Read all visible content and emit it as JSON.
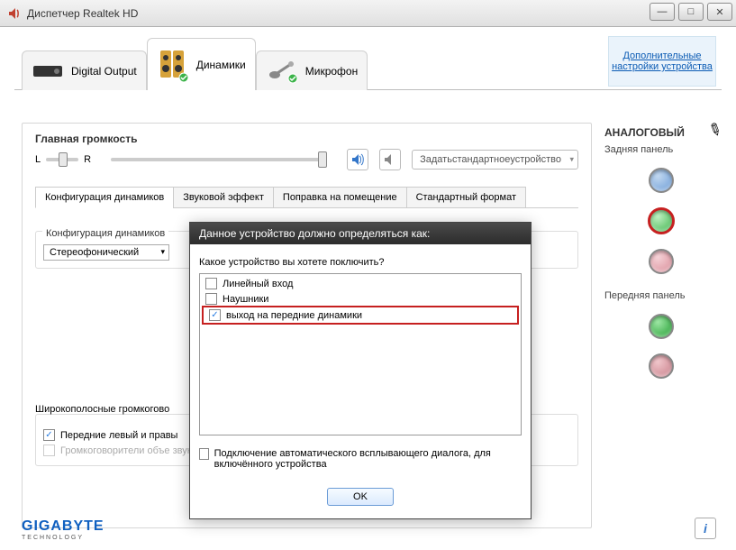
{
  "window": {
    "title": "Диспетчер Realtek HD"
  },
  "device_tabs": {
    "digital": "Digital Output",
    "speakers": "Динамики",
    "mic": "Микрофон"
  },
  "extra_link": "Дополнительные настройки устройства",
  "volume": {
    "label": "Главная громкость",
    "left": "L",
    "right": "R"
  },
  "default_device": {
    "line1": "Задать",
    "line2": "стандартное",
    "line3": "устройство"
  },
  "subtabs": {
    "config": "Конфигурация динамиков",
    "effect": "Звуковой эффект",
    "room": "Поправка на помещение",
    "format": "Стандартный формат"
  },
  "speaker_config": {
    "group_title": "Конфигурация динамиков",
    "value": "Стереофонический"
  },
  "fullrange": {
    "group_title": "Широкополосные громкогово",
    "front_lr": "Передние левый и правы",
    "surround": "Громкоговорители объе звука"
  },
  "analog": {
    "title": "АНАЛОГОВЫЙ",
    "rear": "Задняя панель",
    "front": "Передняя панель"
  },
  "dialog": {
    "title": "Данное устройство должно определяться как:",
    "prompt": "Какое устройство вы хотете поключить?",
    "opts": {
      "line_in": "Линейный вход",
      "headphone": "Наушники",
      "front_out": "выход на передние динамики"
    },
    "auto_popup": "Подключение автоматического всплывающего диалога, для включённого устройства",
    "ok": "OK"
  },
  "brand": {
    "name": "GIGABYTE",
    "sub": "TECHNOLOGY"
  }
}
